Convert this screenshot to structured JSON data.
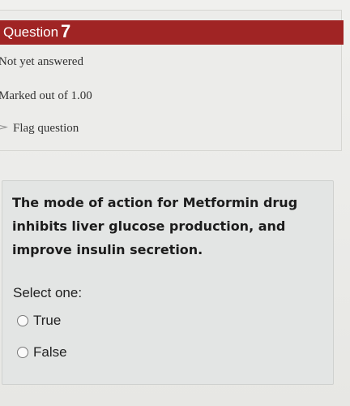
{
  "question": {
    "label": "Question",
    "number": "7",
    "status": "Not yet answered",
    "marks": "Marked out of 1.00",
    "flag_label": "Flag question",
    "text": "The mode of action for Metformin drug inhibits liver glucose production, and improve insulin secretion.",
    "prompt": "Select one:",
    "options": [
      {
        "label": "True"
      },
      {
        "label": "False"
      }
    ]
  },
  "colors": {
    "header_bg": "#a02424",
    "header_text": "#ffffff",
    "panel_bg": "#e3e5e4"
  },
  "icons": {
    "flag": "flag-icon",
    "radio": "radio-button"
  }
}
